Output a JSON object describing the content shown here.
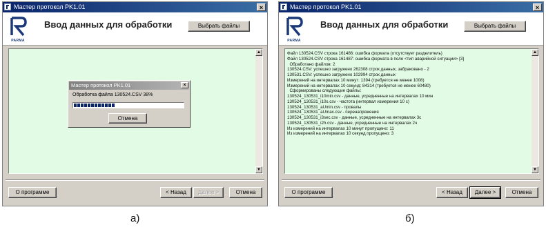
{
  "window_a": {
    "title": "Мастер протокол PK1.01",
    "header_title": "Ввод данных для обработки",
    "logo_text": "PARMA",
    "select_files": "Выбрать файлы",
    "about": "О программе",
    "back": "< Назад",
    "next": "Далее >",
    "cancel": "Отмена",
    "close": "×",
    "progress": {
      "title": "Мастер протокол PK1.01",
      "text": "Обработка файла 130524.CSV  38%",
      "percent": 38,
      "cancel": "Отмена",
      "close": "×"
    }
  },
  "window_b": {
    "title": "Мастер протокол PK1.01",
    "header_title": "Ввод данных для обработки",
    "logo_text": "PARMA",
    "select_files": "Выбрать файлы",
    "about": "О программе",
    "back": "< Назад",
    "next": "Далее >",
    "cancel": "Отмена",
    "close": "×",
    "log": [
      "Файл 130524.CSV строка 161486: ошибка формата (отсутствует разделитель)",
      "Файл 130524.CSV строка 161487: ошибка формата в поле <тип аварийной ситуации> [3]",
      "  Обработано файлов: 2",
      "130524.CSV: успешно загружено 262308 строк данных, забраковано - 2",
      "130531.CSV: успешно загружено 102994 строк данных",
      "Измерений на интервалах 10 минут: 1394 (требуется не менее 1008)",
      "Измерений на интервалах 10 секунд: 84314 (требуется не менее 60480)",
      "  Сформированы следующие файлы:",
      "130524_130531_i10min.csv - данные, усредненные на интервалах 10 мин",
      "130524_130531_i10s.csv - частота (интервал измерения 10 с)",
      "130524_130531_aUmin.csv - провалы",
      "130524_130531_aUmax.csv - перенапряжения",
      "130524_130531_i3sec.csv - данные, усредненные на интервалах 3с",
      "130524_130531_i2h.csv - данные, усредненные на интервалах 2ч",
      "Из измерений на интервалах 10 минут пропущено: 11",
      "Из измерений на интервалах 10 секунд пропущено: 3"
    ]
  },
  "captions": {
    "a": "а)",
    "b": "б)"
  }
}
